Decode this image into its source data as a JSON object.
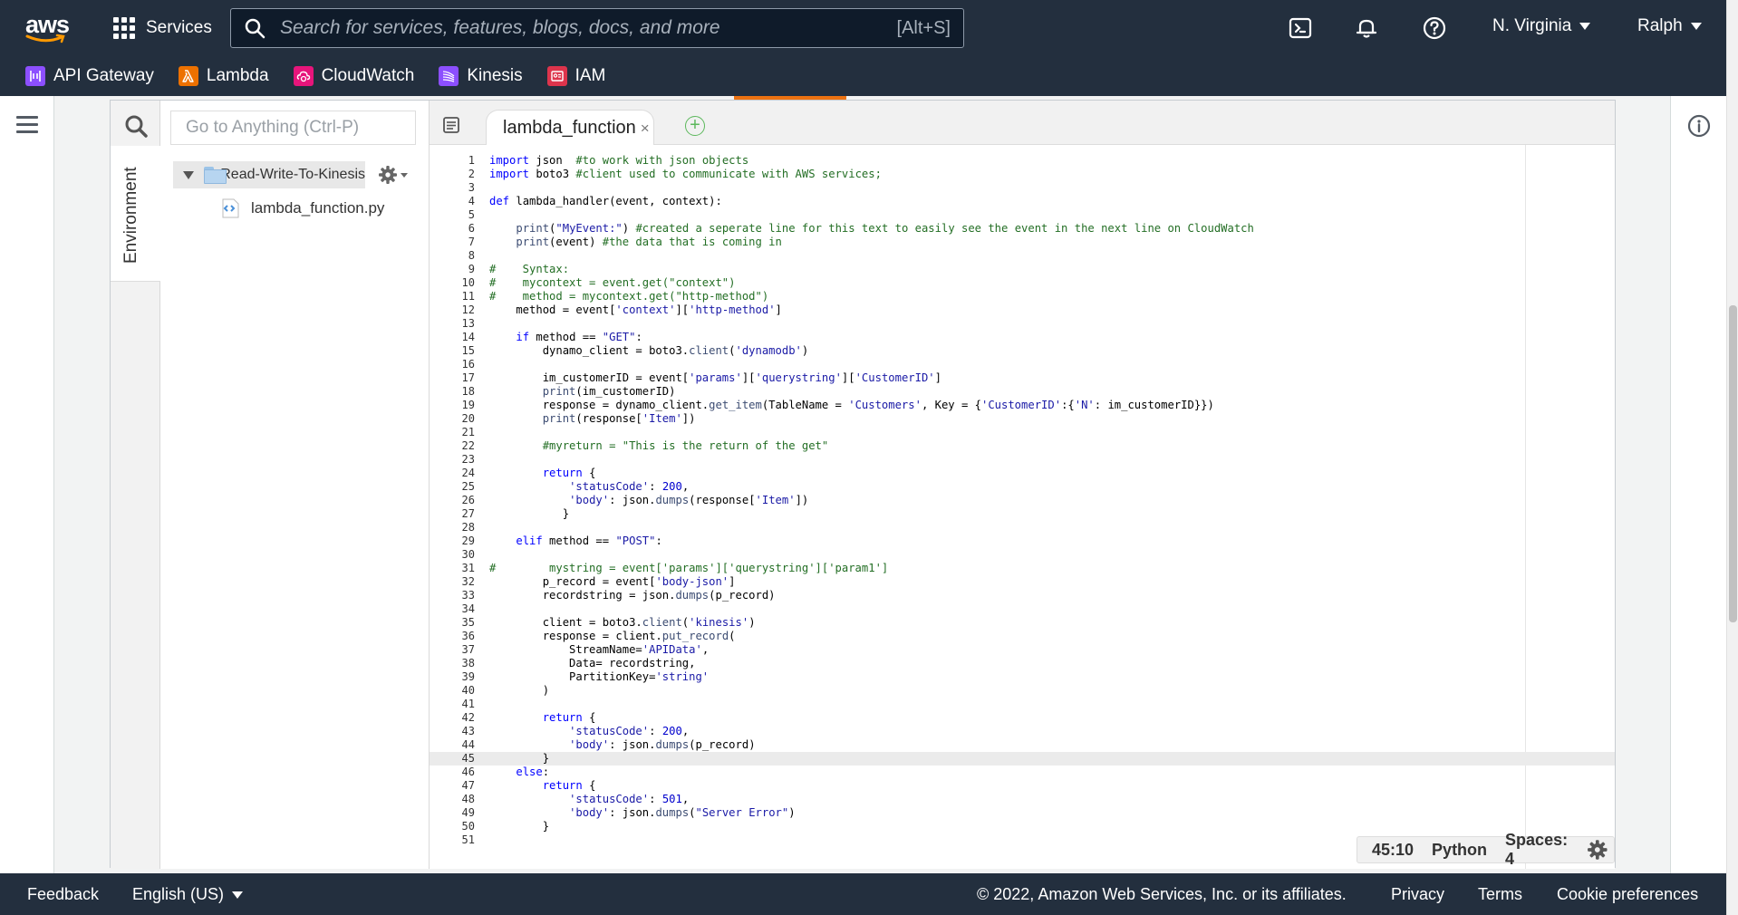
{
  "header": {
    "logo_text": "aws",
    "services_label": "Services",
    "search_placeholder": "Search for services, features, blogs, docs, and more",
    "search_shortcut": "[Alt+S]",
    "region": "N. Virginia",
    "user": "Ralph"
  },
  "favorites": [
    {
      "label": "API Gateway",
      "color": "#8c4fff"
    },
    {
      "label": "Lambda",
      "color": "#ed7100"
    },
    {
      "label": "CloudWatch",
      "color": "#e7157b"
    },
    {
      "label": "Kinesis",
      "color": "#8c4fff"
    },
    {
      "label": "IAM",
      "color": "#dd344c"
    }
  ],
  "ide": {
    "goto_placeholder": "Go to Anything (Ctrl-P)",
    "environment_label": "Environment",
    "tree_root": "Read-Write-To-Kinesis",
    "tree_file": "lambda_function.py",
    "tab_label": "lambda_function",
    "tab_close": "×",
    "add_tab": "+"
  },
  "code": {
    "active_line": 45,
    "lines": [
      "import json  #to work with json objects",
      "import boto3 #client used to communicate with AWS services;",
      "",
      "def lambda_handler(event, context):",
      "",
      "    print(\"MyEvent:\") #created a seperate line for this text to easily see the event in the next line on CloudWatch",
      "    print(event) #the data that is coming in",
      "",
      "#    Syntax:",
      "#    mycontext = event.get(\"context\")",
      "#    method = mycontext.get(\"http-method\")",
      "    method = event['context']['http-method']",
      "",
      "    if method == \"GET\":",
      "        dynamo_client = boto3.client('dynamodb')",
      "",
      "        im_customerID = event['params']['querystring']['CustomerID']",
      "        print(im_customerID)",
      "        response = dynamo_client.get_item(TableName = 'Customers', Key = {'CustomerID':{'N': im_customerID}})",
      "        print(response['Item'])",
      "",
      "        #myreturn = \"This is the return of the get\"",
      "",
      "        return {",
      "            'statusCode': 200,",
      "            'body': json.dumps(response['Item'])",
      "           }",
      "",
      "    elif method == \"POST\":",
      "",
      "#        mystring = event['params']['querystring']['param1']",
      "        p_record = event['body-json']",
      "        recordstring = json.dumps(p_record)",
      "",
      "        client = boto3.client('kinesis')",
      "        response = client.put_record(",
      "            StreamName='APIData',",
      "            Data= recordstring,",
      "            PartitionKey='string'",
      "        )",
      "",
      "        return {",
      "            'statusCode': 200,",
      "            'body': json.dumps(p_record)",
      "        }",
      "    else:",
      "        return {",
      "            'statusCode': 501,",
      "            'body': json.dumps(\"Server Error\")",
      "        }",
      ""
    ]
  },
  "status": {
    "cursor": "45:10",
    "language": "Python",
    "spaces": "Spaces: 4"
  },
  "footer": {
    "feedback": "Feedback",
    "language": "English (US)",
    "copyright": "© 2022, Amazon Web Services, Inc. or its affiliates.",
    "privacy": "Privacy",
    "terms": "Terms",
    "cookies": "Cookie preferences"
  }
}
